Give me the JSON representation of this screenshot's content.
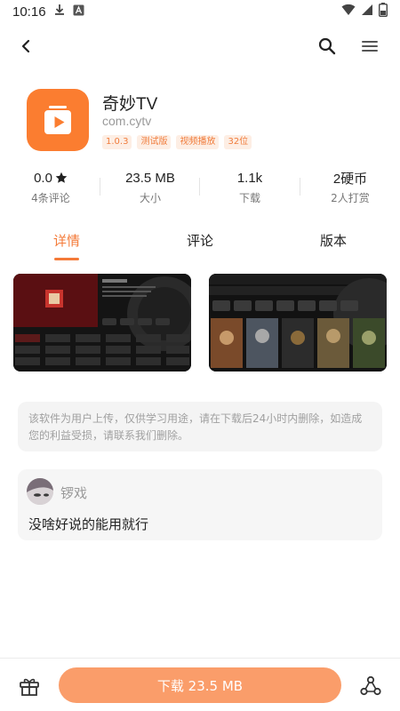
{
  "status_bar": {
    "time": "10:16"
  },
  "app": {
    "name": "奇妙TV",
    "package": "com.cytv",
    "tags": [
      "1.0.3",
      "测试版",
      "视频播放",
      "32位"
    ]
  },
  "stats": [
    {
      "value": "0.0",
      "label": "4条评论",
      "has_star": true
    },
    {
      "value": "23.5 MB",
      "label": "大小"
    },
    {
      "value": "1.1k",
      "label": "下载"
    },
    {
      "value": "2硬币",
      "label": "2人打赏"
    }
  ],
  "tabs": [
    {
      "label": "详情",
      "active": true
    },
    {
      "label": "评论",
      "active": false
    },
    {
      "label": "版本",
      "active": false
    }
  ],
  "screenshots": [
    {
      "caption": "screenshot-1"
    },
    {
      "caption": "screenshot-2"
    }
  ],
  "notice": "该软件为用户上传，仅供学习用途，请在下载后24小时内删除，如造成您的利益受损，请联系我们删除。",
  "comment": {
    "username": "锣戏",
    "text": "没啥好说的能用就行"
  },
  "download": {
    "label": "下载 23.5 MB"
  },
  "colors": {
    "accent": "#f47a38",
    "icon_bg": "#fb7d30",
    "button": "#fa9d6a"
  }
}
